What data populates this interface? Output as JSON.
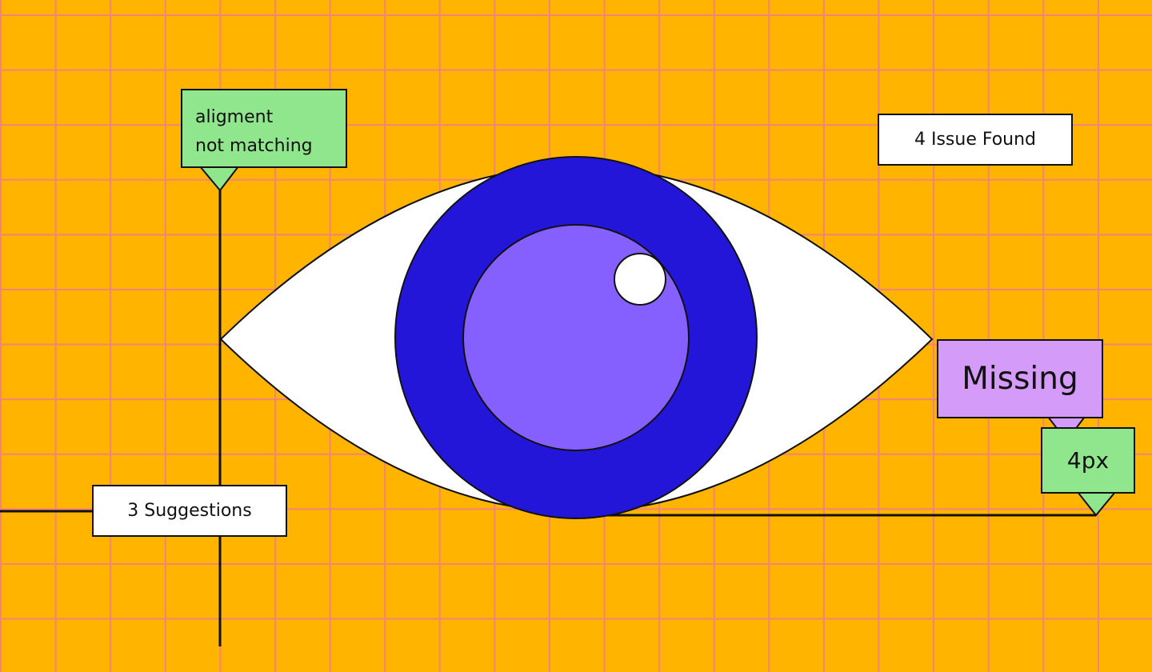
{
  "colors": {
    "background": "#FFB500",
    "grid": "#F3827B",
    "iris_outer": "#2416D9",
    "iris_inner": "#8660FF",
    "sclera": "#FFFFFF",
    "tag_green": "#8FE68C",
    "tag_purple": "#D49CF8",
    "tag_white": "#FFFFFF",
    "ink": "#111111"
  },
  "labels": {
    "alignment_line1": "aligment",
    "alignment_line2": "not matching",
    "issues": "4 Issue Found",
    "suggestions": "3 Suggestions",
    "missing": "Missing",
    "spacing": "4px"
  },
  "icons": {
    "eye": "eye-icon",
    "highlight": "eye-highlight"
  }
}
